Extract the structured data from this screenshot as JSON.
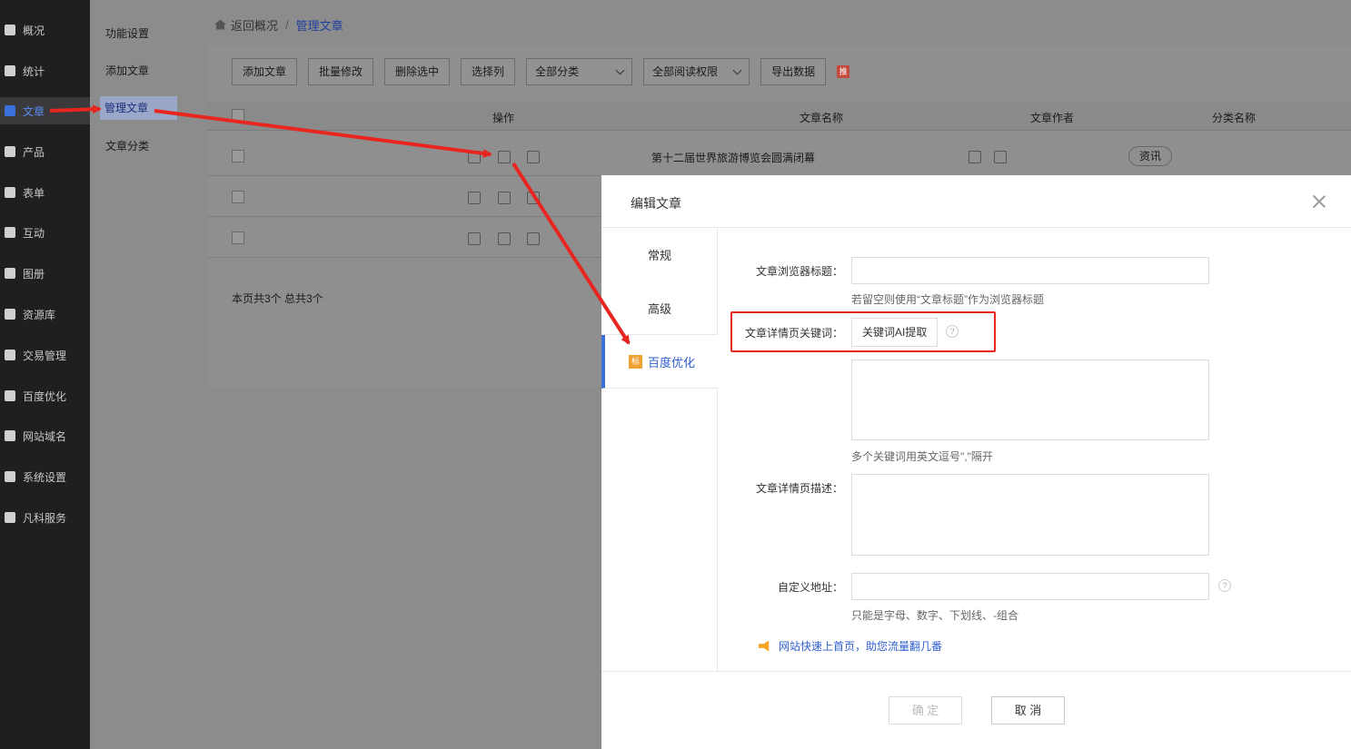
{
  "nav": {
    "items": [
      {
        "label": "概况",
        "icon": "home-icon"
      },
      {
        "label": "统计",
        "icon": "chart-icon"
      },
      {
        "label": "文章",
        "icon": "article-icon"
      },
      {
        "label": "产品",
        "icon": "grid-icon"
      },
      {
        "label": "表单",
        "icon": "form-icon"
      },
      {
        "label": "互动",
        "icon": "chat-icon"
      },
      {
        "label": "图册",
        "icon": "album-icon"
      },
      {
        "label": "资源库",
        "icon": "database-icon"
      },
      {
        "label": "交易管理",
        "icon": "trade-icon"
      },
      {
        "label": "百度优化",
        "icon": "seo-icon"
      },
      {
        "label": "网站域名",
        "icon": "domain-icon"
      },
      {
        "label": "系统设置",
        "icon": "gear-icon"
      },
      {
        "label": "凡科服务",
        "icon": "heart-icon"
      }
    ]
  },
  "subnav": {
    "items": [
      "功能设置",
      "添加文章",
      "管理文章",
      "文章分类"
    ]
  },
  "breadcrumb": {
    "back": "返回概况",
    "separator": "/",
    "current": "管理文章"
  },
  "toolbar": {
    "add": "添加文章",
    "batch_edit": "批量修改",
    "delete_selected": "删除选中",
    "select_columns": "选择列",
    "category_select": "全部分类",
    "permission_select": "全部阅读权限",
    "export": "导出数据",
    "badge": "推"
  },
  "table": {
    "headers": {
      "ops": "操作",
      "name": "文章名称",
      "author": "文章作者",
      "category": "分类名称"
    },
    "rows": [
      {
        "name": "第十二届世界旅游博览会圆满闭幕",
        "category": "资讯"
      }
    ],
    "summary": "本页共3个   总共3个"
  },
  "modal": {
    "title": "编辑文章",
    "tabs": [
      "常规",
      "高级",
      "百度优化"
    ],
    "tab_badge": "标",
    "fields": {
      "browser_title_label": "文章浏览器标题：",
      "browser_title_hint": "若留空则使用“文章标题”作为浏览器标题",
      "keywords_label": "文章详情页关键词：",
      "ai_button": "关键词AI提取",
      "keywords_hint": "多个关键词用英文逗号\",\"隔开",
      "description_label": "文章详情页描述：",
      "custom_url_label": "自定义地址：",
      "custom_url_hint": "只能是字母、数字、下划线、-组合",
      "help": "?"
    },
    "promo": "网站快速上首页，助您流量翻几番",
    "ok": "确 定",
    "cancel": "取 消"
  },
  "colors": {
    "accent": "#2f5fd0",
    "annotation": "#e8251f",
    "nav_bg": "#1f1f21"
  }
}
